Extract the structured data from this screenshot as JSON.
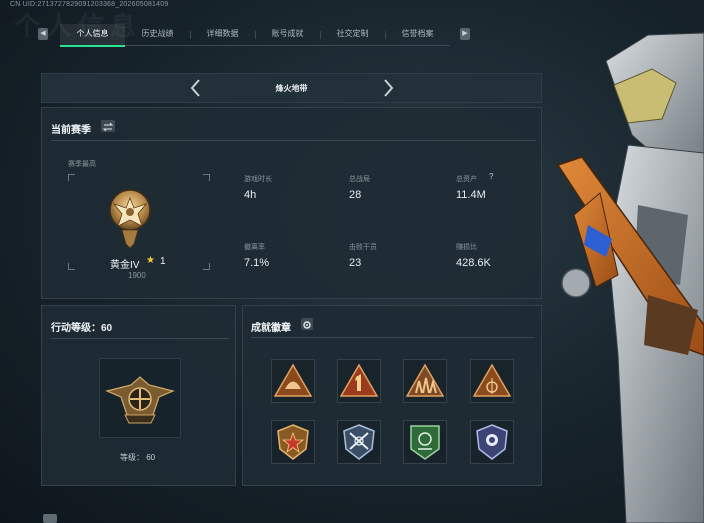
{
  "window": {
    "uid": "CN UID:2713727829091203368_202605081409",
    "watermark_title": "个人信息"
  },
  "tabs": [
    {
      "label": "个人信息",
      "active": true
    },
    {
      "label": "历史战绩",
      "active": false
    },
    {
      "label": "详细数据",
      "active": false
    },
    {
      "label": "账号成就",
      "active": false
    },
    {
      "label": "社交定制",
      "active": false
    },
    {
      "label": "信誉档案",
      "active": false
    }
  ],
  "mode": {
    "label": "烽火地带"
  },
  "season": {
    "title": "当前赛季",
    "best_label": "赛季最高",
    "rank_name": "黄金IV",
    "rank_stars": "1",
    "rank_points": "1900",
    "stats": [
      {
        "label": "游戏时长",
        "value": "4h"
      },
      {
        "label": "总战局",
        "value": "28"
      },
      {
        "label": "总资产",
        "value": "11.4M"
      },
      {
        "label": "撤离率",
        "value": "7.1%"
      },
      {
        "label": "击败干员",
        "value": "23"
      },
      {
        "label": "赚损比",
        "value": "428.6K"
      }
    ],
    "help_glyph": "?"
  },
  "action_level": {
    "title": "行动等级：60",
    "caption": "等级： 60"
  },
  "badges": {
    "title": "成就徽章",
    "items": [
      {
        "icon": "helmet-triangle-badge-icon"
      },
      {
        "icon": "number-one-triangle-badge-icon"
      },
      {
        "icon": "soldiers-triangle-badge-icon"
      },
      {
        "icon": "target-triangle-badge-icon"
      },
      {
        "icon": "star-shield-badge-icon"
      },
      {
        "icon": "crossed-rifles-shield-badge-icon"
      },
      {
        "icon": "green-emblem-shield-badge-icon"
      },
      {
        "icon": "police-shield-badge-icon"
      }
    ]
  },
  "colors": {
    "accent_green": "#2ee38f",
    "panel_bg": "#1e2b34",
    "gold": "#c9a560"
  }
}
